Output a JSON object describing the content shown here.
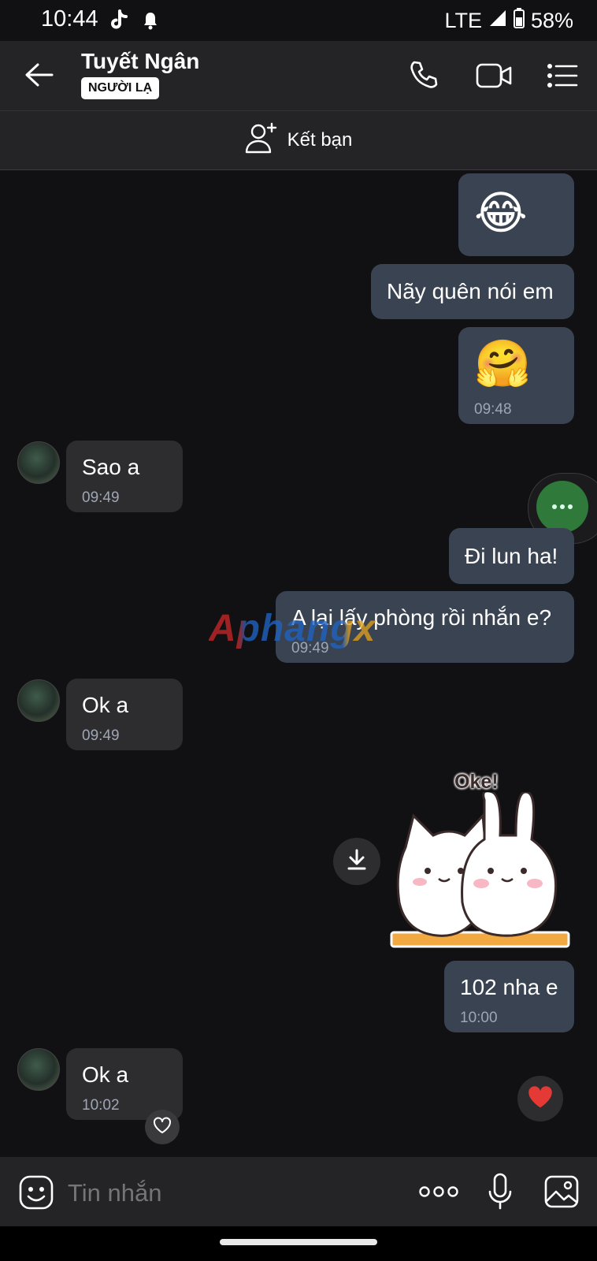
{
  "status_bar": {
    "time": "10:44",
    "network": "LTE",
    "battery": "58%"
  },
  "header": {
    "contact_name": "Tuyết Ngân",
    "badge": "NGƯỜI LẠ"
  },
  "add_friend": {
    "label": "Kết bạn"
  },
  "messages": [
    {
      "side": "mine",
      "emoji": "😂"
    },
    {
      "side": "mine",
      "text": "Nãy quên nói em"
    },
    {
      "side": "mine",
      "emoji": "🤗",
      "time": "09:48"
    },
    {
      "side": "theirs",
      "text": "Sao a",
      "time": "09:49"
    },
    {
      "side": "mine",
      "text": "Đi lun ha!"
    },
    {
      "side": "mine",
      "text": "A lại lấy phòng rồi nhắn e?",
      "time": "09:49"
    },
    {
      "side": "theirs",
      "text": "Ok a",
      "time": "09:49"
    },
    {
      "side": "mine",
      "sticker_text": "Oke!"
    },
    {
      "side": "mine",
      "text": "102 nha e",
      "time": "10:00"
    },
    {
      "side": "theirs",
      "text": "Ok a",
      "time": "10:02"
    }
  ],
  "watermark": "Aphangx",
  "composer": {
    "placeholder": "Tin nhắn"
  },
  "colors": {
    "mine_bubble": "#3a4351",
    "theirs_bubble": "#2d2d30",
    "fab": "#2f7a3b",
    "heart": "#e53935"
  }
}
